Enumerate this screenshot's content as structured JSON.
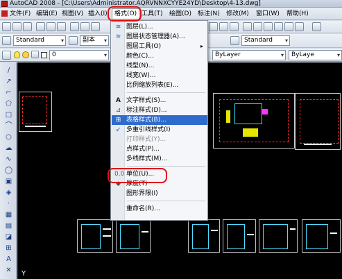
{
  "window": {
    "title": "AutoCAD 2008 - [C:\\Users\\Administrator.AQRVNNXCYYE24YD\\Desktop\\4-13.dwg]"
  },
  "menubar": {
    "items": [
      "文件(F)",
      "编辑(E)",
      "视图(V)",
      "插入(I)",
      "格式(O)",
      "工具(T)",
      "绘图(D)",
      "标注(N)",
      "修改(M)",
      "窗口(W)",
      "帮助(H)"
    ],
    "active_index": 4
  },
  "toolbar2": {
    "text_style": "Standard",
    "dim_style": "副本",
    "table_style": "Standard"
  },
  "toolbar3": {
    "layer": "0",
    "linetype": "ByLayer",
    "lineweight": "ByLaye"
  },
  "format_menu": {
    "items": [
      {
        "label": "图层(L)...",
        "icon": "layer-icon",
        "state": "normal"
      },
      {
        "label": "图层状态管理器(A)...",
        "icon": "layer-state-icon",
        "state": "normal"
      },
      {
        "label": "图层工具(O)",
        "icon": "",
        "state": "submenu",
        "arrow": "▸"
      },
      {
        "label": "颜色(C)...",
        "icon": "",
        "state": "normal"
      },
      {
        "label": "线型(N)...",
        "icon": "",
        "state": "normal"
      },
      {
        "label": "线宽(W)...",
        "icon": "",
        "state": "normal"
      },
      {
        "label": "比例缩放列表(E)...",
        "icon": "",
        "state": "normal"
      },
      {
        "label": "文字样式(S)...",
        "icon": "text-style-icon",
        "state": "normal"
      },
      {
        "label": "标注样式(D)...",
        "icon": "dim-style-icon",
        "state": "normal"
      },
      {
        "label": "表格样式(B)...",
        "icon": "table-style-icon",
        "state": "highlighted"
      },
      {
        "label": "多重引线样式(I)",
        "icon": "mleader-style-icon",
        "state": "normal"
      },
      {
        "label": "打印样式(Y)...",
        "icon": "",
        "state": "disabled"
      },
      {
        "label": "点样式(P)...",
        "icon": "",
        "state": "normal"
      },
      {
        "label": "多线样式(M)...",
        "icon": "",
        "state": "normal"
      },
      {
        "label": "单位(U)...",
        "icon": "units-icon",
        "state": "normal"
      },
      {
        "label": "厚度(T)",
        "icon": "thickness-icon",
        "state": "normal"
      },
      {
        "label": "图形界限(I)",
        "icon": "",
        "state": "normal"
      },
      {
        "label": "重命名(R)...",
        "icon": "",
        "state": "normal"
      }
    ]
  },
  "colors": {
    "highlight": "#2f6bcc",
    "annotation": "#e01010",
    "canvas": "#000000"
  },
  "canvas": {
    "ucs_label": "Y"
  }
}
